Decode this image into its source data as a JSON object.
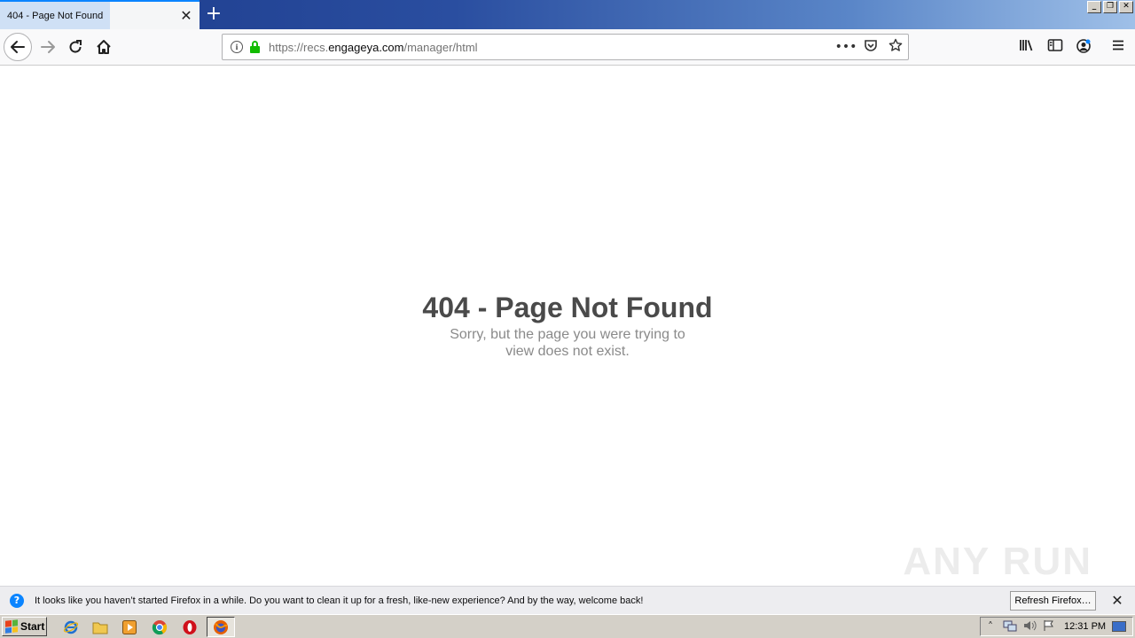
{
  "browser": {
    "tab_title": "404 - Page Not Found",
    "tab_close": "✕",
    "new_tab": "+",
    "url_prefix": "https://recs.",
    "url_domain": "engageya.com",
    "url_path": "/manager/html",
    "page_actions": "•••",
    "window_controls": [
      "_",
      "❐",
      "✕"
    ]
  },
  "page": {
    "title": "404 - Page Not Found",
    "message": "Sorry, but the page you were trying to view does not exist."
  },
  "notification": {
    "text": "It looks like you haven’t started Firefox in a while. Do you want to clean it up for a fresh, like-new experience? And by the way, welcome back!",
    "refresh_label": "Refresh Firefox…",
    "close": "✕"
  },
  "taskbar": {
    "start_label": "Start",
    "clock": "12:31 PM"
  },
  "watermark": "ANY RUN",
  "icons": {
    "back": "back-arrow-icon",
    "forward": "forward-arrow-icon",
    "reload": "reload-icon",
    "home": "home-icon",
    "info": "info-icon",
    "lock": "lock-icon",
    "pocket": "pocket-icon",
    "bookmark": "star-icon",
    "library": "library-icon",
    "sidebar": "sidebar-icon",
    "account": "account-icon",
    "menu": "hamburger-menu-icon"
  },
  "colors": {
    "accent": "#0a84ff",
    "lock": "#12bc00",
    "title_text": "#4a4a4a",
    "message_text": "#8a8a8a"
  }
}
